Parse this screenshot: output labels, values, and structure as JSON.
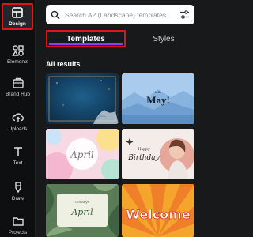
{
  "sidebar": {
    "items": [
      {
        "label": "Design",
        "icon": "layout-icon"
      },
      {
        "label": "Elements",
        "icon": "shapes-icon"
      },
      {
        "label": "Brand Hub",
        "icon": "brand-icon"
      },
      {
        "label": "Uploads",
        "icon": "upload-icon"
      },
      {
        "label": "Text",
        "icon": "text-icon"
      },
      {
        "label": "Draw",
        "icon": "pen-icon"
      },
      {
        "label": "Projects",
        "icon": "folder-icon"
      }
    ]
  },
  "search": {
    "placeholder": "Search A2 (Landscape) templates",
    "value": ""
  },
  "tabs": [
    {
      "label": "Templates",
      "active": true
    },
    {
      "label": "Styles",
      "active": false
    }
  ],
  "results": {
    "title": "All results",
    "templates": [
      {
        "text": ""
      },
      {
        "text": "May!",
        "subtext": "hello"
      },
      {
        "text": "April"
      },
      {
        "text": "Birthday",
        "subtext": "Happy"
      },
      {
        "text": "April",
        "subtext": "Goodbye"
      },
      {
        "text": "Welcome"
      }
    ]
  },
  "colors": {
    "accent": "#8b3dff",
    "highlight": "#e0131c",
    "background": "#18191b"
  }
}
